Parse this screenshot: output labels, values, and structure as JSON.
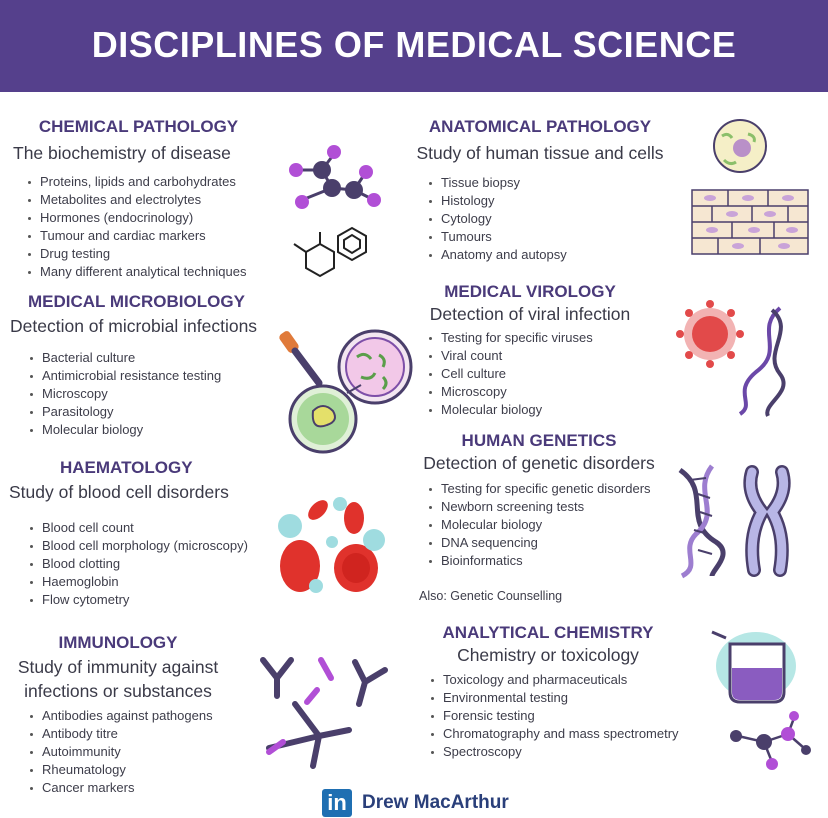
{
  "title": "DISCIPLINES OF MEDICAL SCIENCE",
  "sections": {
    "chemical_pathology": {
      "heading": "CHEMICAL PATHOLOGY",
      "subtitle": "The biochemistry of disease",
      "items": [
        "Proteins, lipids and carbohydrates",
        "Metabolites and electrolytes",
        "Hormones (endocrinology)",
        "Tumour and cardiac markers",
        "Drug testing",
        "Many different analytical techniques"
      ]
    },
    "medical_microbiology": {
      "heading": "MEDICAL MICROBIOLOGY",
      "subtitle": "Detection of microbial infections",
      "items": [
        "Bacterial culture",
        "Antimicrobial resistance testing",
        "Microscopy",
        "Parasitology",
        "Molecular biology"
      ]
    },
    "haematology": {
      "heading": "HAEMATOLOGY",
      "subtitle": "Study of blood cell disorders",
      "items": [
        "Blood cell count",
        "Blood cell morphology (microscopy)",
        "Blood clotting",
        "Haemoglobin",
        "Flow cytometry"
      ]
    },
    "immunology": {
      "heading": "IMMUNOLOGY",
      "subtitle_line1": "Study of immunity against",
      "subtitle_line2": "infections or substances",
      "items": [
        "Antibodies against pathogens",
        "Antibody titre",
        "Autoimmunity",
        "Rheumatology",
        "Cancer markers"
      ]
    },
    "anatomical_pathology": {
      "heading": "ANATOMICAL PATHOLOGY",
      "subtitle": "Study of human tissue and cells",
      "items": [
        "Tissue biopsy",
        "Histology",
        "Cytology",
        "Tumours",
        "Anatomy and autopsy"
      ]
    },
    "medical_virology": {
      "heading": "MEDICAL VIROLOGY",
      "subtitle": "Detection of viral infection",
      "items": [
        "Testing for specific viruses",
        "Viral count",
        "Cell culture",
        "Microscopy",
        "Molecular biology"
      ]
    },
    "human_genetics": {
      "heading": "HUMAN GENETICS",
      "subtitle": "Detection of genetic disorders",
      "items": [
        "Testing for specific genetic disorders",
        "Newborn screening tests",
        "Molecular biology",
        "DNA sequencing",
        "Bioinformatics"
      ],
      "note": "Also: Genetic Counselling"
    },
    "analytical_chemistry": {
      "heading": "ANALYTICAL CHEMISTRY",
      "subtitle": "Chemistry or toxicology",
      "items": [
        "Toxicology and pharmaceuticals",
        "Environmental testing",
        "Forensic testing",
        "Chromatography and mass spectrometry",
        "Spectroscopy"
      ]
    }
  },
  "footer": {
    "logo_text": "in",
    "author": "Drew MacArthur"
  },
  "colors": {
    "banner": "#55408c",
    "heading": "#4a3a7a",
    "accent_purple": "#b14fd6",
    "blood_red": "#e0322c",
    "linkedin_blue": "#1f6fb2"
  }
}
